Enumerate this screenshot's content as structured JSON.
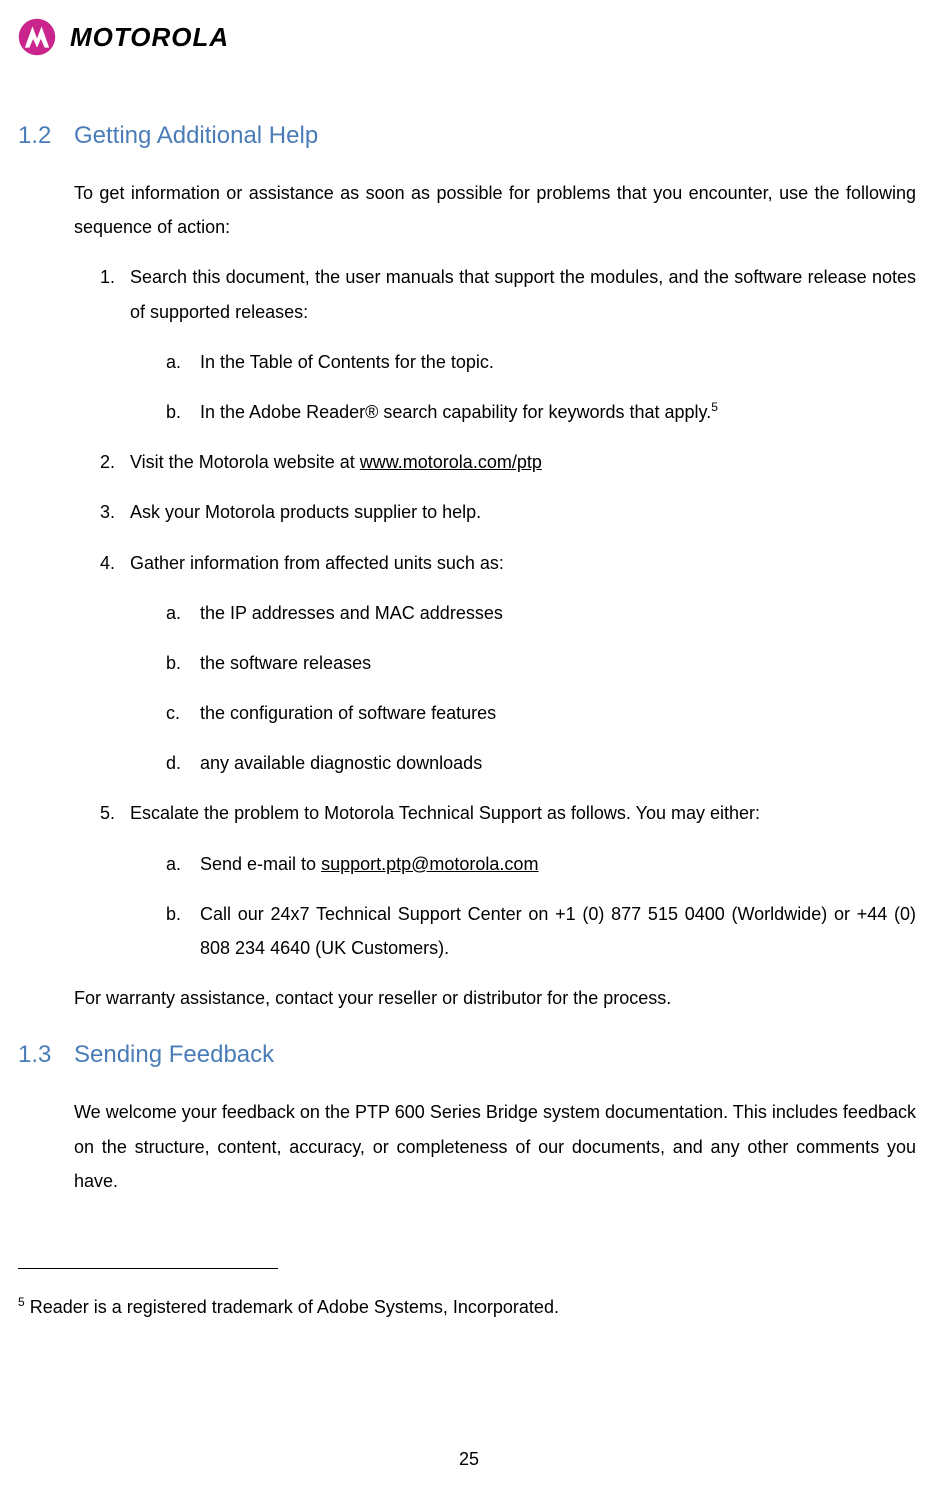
{
  "header": {
    "brand_word": "MOTOROLA"
  },
  "section_12": {
    "number": "1.2",
    "title": "Getting Additional Help",
    "intro": "To get information or assistance as soon as possible for problems that you encounter, use the following sequence of action:",
    "item1_text": "Search this document, the user manuals that support the modules, and the software release notes of supported releases:",
    "item1_sub_a": "In the Table of Contents for the topic.",
    "item1_sub_b_pre": "In the Adobe Reader® search capability for keywords that apply.",
    "item1_sub_b_sup": "5",
    "item2_pre": "Visit the Motorola website at ",
    "item2_link": "www.motorola.com/ptp",
    "item3": "Ask your Motorola products supplier to help.",
    "item4_text": "Gather information from affected units such as:",
    "item4_sub_a": "the IP addresses and MAC addresses",
    "item4_sub_b": "the software releases",
    "item4_sub_c": "the configuration of software features",
    "item4_sub_d": "any available diagnostic downloads",
    "item5_text": "Escalate the problem to Motorola Technical Support as follows. You may either:",
    "item5_sub_a_pre": "Send e-mail to ",
    "item5_sub_a_link": "support.ptp@motorola.com",
    "item5_sub_b": "Call our 24x7 Technical Support Center on +1 (0) 877 515 0400 (Worldwide) or +44 (0) 808 234 4640 (UK Customers).",
    "outro": "For warranty assistance, contact your reseller or distributor for the process."
  },
  "section_13": {
    "number": "1.3",
    "title": "Sending Feedback",
    "body": "We welcome your feedback on the PTP 600 Series Bridge system documentation. This includes feedback on the structure, content, accuracy, or completeness of our documents, and any other comments you have."
  },
  "footnote": {
    "marker": "5",
    "text": " Reader is a registered trademark of Adobe Systems, Incorporated."
  },
  "page_number": "25"
}
